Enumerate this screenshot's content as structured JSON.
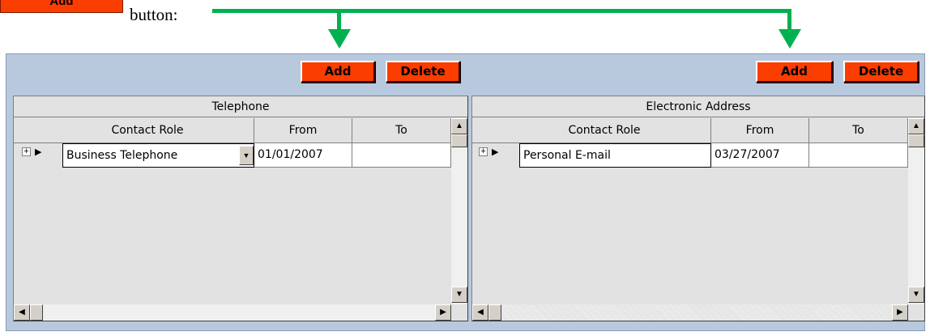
{
  "annotation": {
    "button_label": "Add",
    "suffix": "button:",
    "arrow_color": "#00b050"
  },
  "accent_color": "#fb3d00",
  "panel_color": "#b8c9dd",
  "left": {
    "add_label": "Add",
    "delete_label": "Delete",
    "title": "Telephone",
    "columns": [
      "Contact Role",
      "From",
      "To"
    ],
    "rows": [
      {
        "role": "Business Telephone",
        "from": "01/01/2007",
        "to": ""
      }
    ]
  },
  "right": {
    "add_label": "Add",
    "delete_label": "Delete",
    "title": "Electronic Address",
    "columns": [
      "Contact Role",
      "From",
      "To"
    ],
    "rows": [
      {
        "role": "Personal E-mail",
        "from": "03/27/2007",
        "to": ""
      }
    ]
  },
  "icons": {
    "expand": "plus-box-icon",
    "row_indicator": "row-pointer-icon",
    "dropdown": "dropdown-arrow-icon",
    "scroll_up": "scroll-up-icon",
    "scroll_down": "scroll-down-icon",
    "scroll_left": "scroll-left-icon",
    "scroll_right": "scroll-right-icon"
  }
}
